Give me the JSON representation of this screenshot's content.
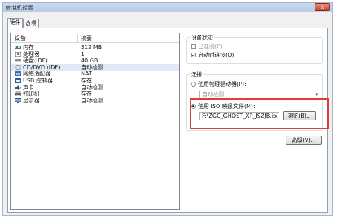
{
  "window": {
    "title": "虚拟机设置",
    "close_label": "x"
  },
  "tabs": [
    {
      "label": "硬件"
    },
    {
      "label": "选项"
    }
  ],
  "device_list": {
    "columns": {
      "device": "设备",
      "summary": "摘要"
    },
    "rows": [
      {
        "name": "内存",
        "value": "512 MB",
        "icon": "memory-icon"
      },
      {
        "name": "处理器",
        "value": "1",
        "icon": "processor-icon"
      },
      {
        "name": "硬盘(IDE)",
        "value": "40 GB",
        "icon": "hard-disk-icon"
      },
      {
        "name": "CD/DVD (IDE)",
        "value": "自动检测",
        "icon": "cd-dvd-icon",
        "selected": true
      },
      {
        "name": "网络适配器",
        "value": "NAT",
        "icon": "network-adapter-icon"
      },
      {
        "name": "USB 控制器",
        "value": "存在",
        "icon": "usb-icon"
      },
      {
        "name": "声卡",
        "value": "自动检测",
        "icon": "sound-card-icon"
      },
      {
        "name": "打印机",
        "value": "存在",
        "icon": "printer-icon"
      },
      {
        "name": "显示器",
        "value": "自动检测",
        "icon": "display-icon"
      }
    ]
  },
  "device_status": {
    "title": "设备状态",
    "connected": {
      "label": "已连接(C)",
      "checked": false
    },
    "connect_at_power_on": {
      "label": "启动时连接(O)",
      "checked": true
    }
  },
  "connection": {
    "title": "连接",
    "physical_drive": {
      "label": "使用物理驱动器(P):",
      "selected": false,
      "combo_value": "自动检测"
    },
    "iso_image": {
      "label": "使用 ISO 映像文件(M):",
      "selected": true,
      "path_value": "F:\\ZGC_GHOST_XP_JSZJB.is",
      "browse_label": "浏览(B)..."
    }
  },
  "advanced_button": "高级(V)...",
  "colors": {
    "highlight_box": "#e03c3c",
    "selection": "#dfe9f5"
  }
}
